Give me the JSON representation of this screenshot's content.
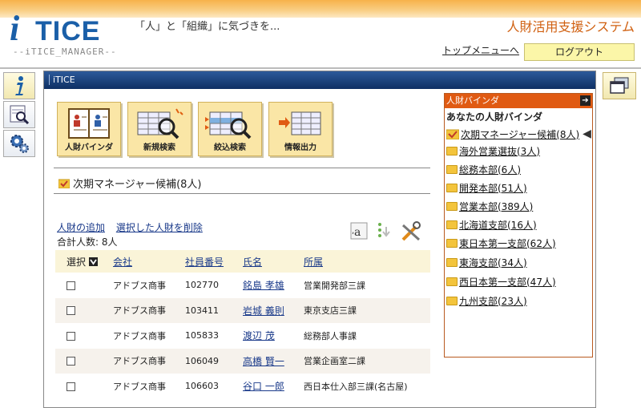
{
  "header": {
    "logo_main": "TICE",
    "logo_i": "i",
    "logo_sub": "--iTICE_MANAGER--",
    "tagline": "「人」と「組織」に気づきを...",
    "system_title": "人財活用支援システム",
    "top_menu_link": "トップメニューへ",
    "logout_label": "ログアウト"
  },
  "panel": {
    "tab_label": "iTICE",
    "tools": [
      {
        "label": "人財バインダ",
        "icon": "binder-icon"
      },
      {
        "label": "新規検索",
        "icon": "new-search-icon"
      },
      {
        "label": "絞込検索",
        "icon": "filter-search-icon"
      },
      {
        "label": "情報出力",
        "icon": "export-icon"
      }
    ],
    "binder_title": "次期マネージャー候補(8人)",
    "add_person": "人財の追加",
    "delete_selected": "選択した人財を削除",
    "total": "合計人数: 8人"
  },
  "table": {
    "headers": [
      "選択",
      "会社",
      "社員番号",
      "氏名",
      "所属"
    ],
    "rows": [
      {
        "company": "アドブス商事",
        "id": "102770",
        "name": "銘島 孝雄",
        "dept": "営業開発部三課"
      },
      {
        "company": "アドブス商事",
        "id": "103411",
        "name": "岩城 義則",
        "dept": "東京支店三課"
      },
      {
        "company": "アドブス商事",
        "id": "105833",
        "name": "渡辺 茂",
        "dept": "総務部人事課"
      },
      {
        "company": "アドブス商事",
        "id": "106049",
        "name": "高橋 賢一",
        "dept": "営業企画室二課"
      },
      {
        "company": "アドブス商事",
        "id": "106603",
        "name": "谷口 一郎",
        "dept": "西日本仕入部三課(名古屋)"
      }
    ]
  },
  "binder_list": {
    "head": "人財バインダ",
    "sub": "あなたの人財バインダ",
    "items": [
      "次期マネージャー候補(8人)",
      "海外営業選抜(3人)",
      "総務本部(6人)",
      "開発本部(51人)",
      "営業本部(389人)",
      "北海道支部(16人)",
      "東日本第一支部(62人)",
      "東海支部(34人)",
      "西日本第一支部(47人)",
      "九州支部(23人)"
    ]
  }
}
